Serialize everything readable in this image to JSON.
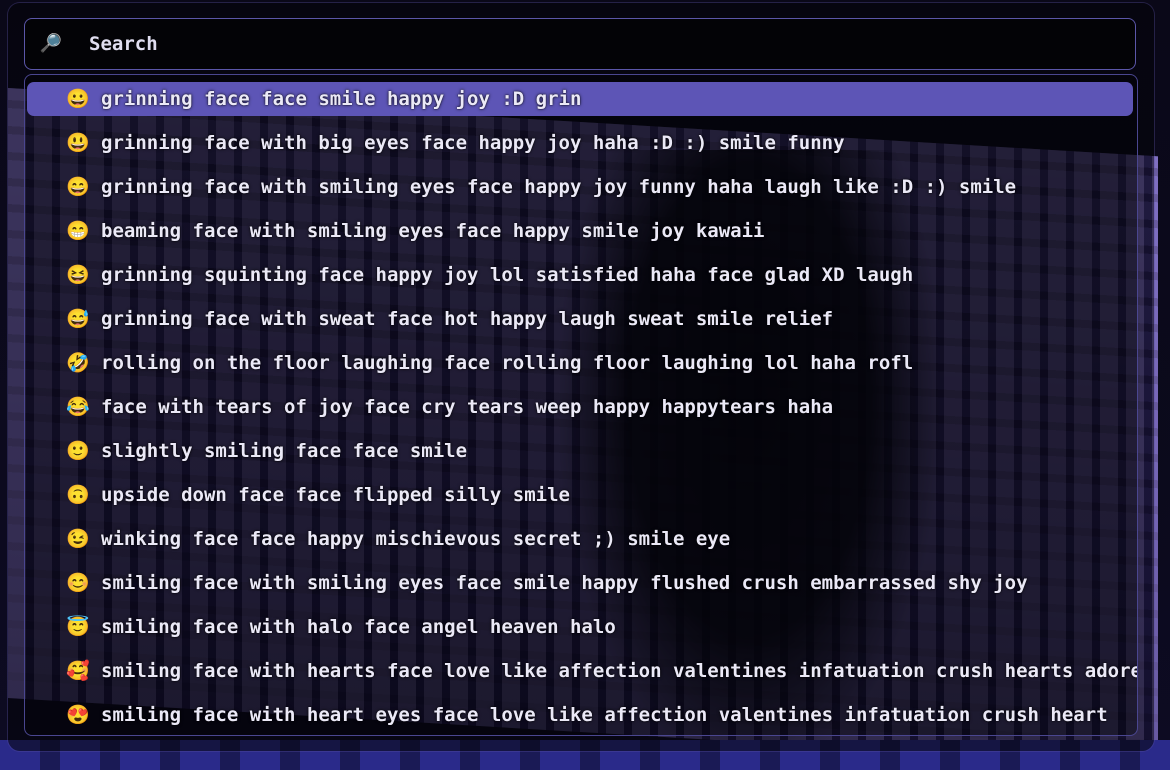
{
  "search": {
    "icon": "magnifying-glass-icon",
    "icon_glyph": "🔎",
    "placeholder": "Search",
    "value": ""
  },
  "results": {
    "selected_index": 0,
    "items": [
      {
        "emoji": "😀",
        "label": "grinning face face smile happy joy :D grin"
      },
      {
        "emoji": "😃",
        "label": "grinning face with big eyes face happy joy haha :D :) smile funny"
      },
      {
        "emoji": "😄",
        "label": "grinning face with smiling eyes face happy joy funny haha laugh like :D :) smile"
      },
      {
        "emoji": "😁",
        "label": "beaming face with smiling eyes face happy smile joy kawaii"
      },
      {
        "emoji": "😆",
        "label": "grinning squinting face happy joy lol satisfied haha face glad XD laugh"
      },
      {
        "emoji": "😅",
        "label": "grinning face with sweat face hot happy laugh sweat smile relief"
      },
      {
        "emoji": "🤣",
        "label": "rolling on the floor laughing face rolling floor laughing lol haha rofl"
      },
      {
        "emoji": "😂",
        "label": "face with tears of joy face cry tears weep happy happytears haha"
      },
      {
        "emoji": "🙂",
        "label": "slightly smiling face face smile"
      },
      {
        "emoji": "🙃",
        "label": "upside down face face flipped silly smile"
      },
      {
        "emoji": "😉",
        "label": "winking face face happy mischievous secret ;) smile eye"
      },
      {
        "emoji": "😊",
        "label": "smiling face with smiling eyes face smile happy flushed crush embarrassed shy joy"
      },
      {
        "emoji": "😇",
        "label": "smiling face with halo face angel heaven halo"
      },
      {
        "emoji": "🥰",
        "label": "smiling face with hearts face love like affection valentines infatuation crush hearts adore"
      },
      {
        "emoji": "😍",
        "label": "smiling face with heart eyes face love like affection valentines infatuation crush heart"
      }
    ]
  },
  "colors": {
    "selection": "#5d55b6",
    "border": "#5b56a8",
    "text": "#ebe9f7"
  }
}
